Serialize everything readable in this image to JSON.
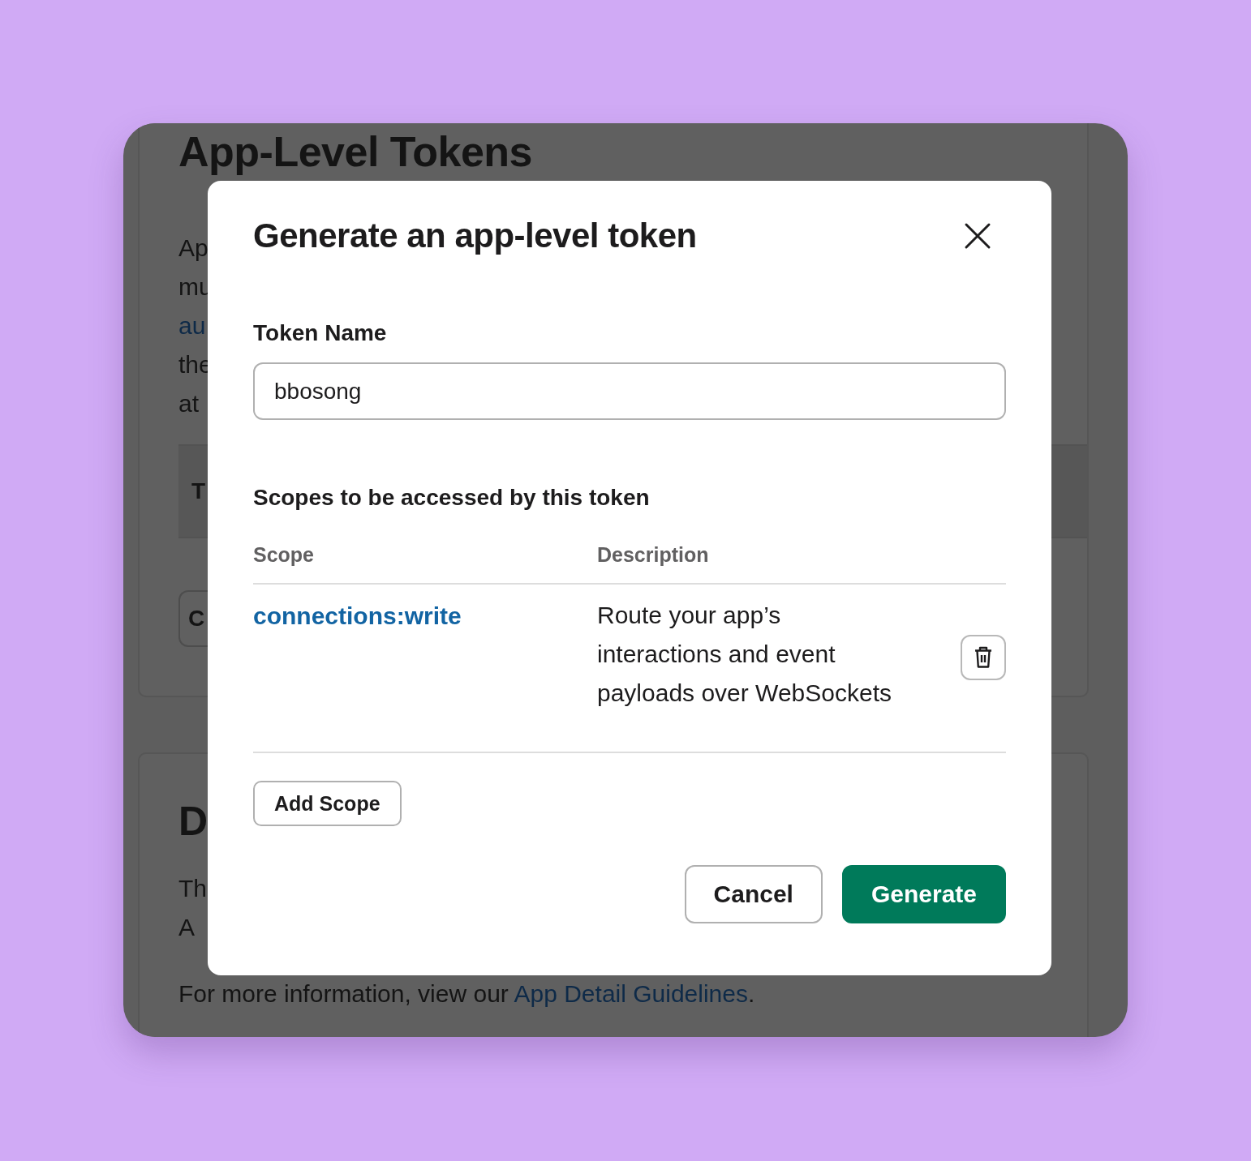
{
  "background_page": {
    "heading": "App-Level Tokens",
    "intro_lines": [
      {
        "text": "Ap",
        "kind": "text"
      },
      {
        "text": "mu",
        "kind": "text"
      },
      {
        "text": "au",
        "kind": "link"
      },
      {
        "text": "the",
        "kind": "text"
      },
      {
        "text": "at",
        "kind": "text"
      }
    ],
    "table_header": "T",
    "button": "C",
    "section_heading": "D",
    "section_lines": [
      "Th",
      "A"
    ],
    "info": {
      "text": "For more information, view our ",
      "link": "App Detail Guidelines",
      "end": "."
    }
  },
  "dialog": {
    "title": "Generate an app-level token",
    "token_name": {
      "label": "Token Name",
      "value": "bbosong"
    },
    "scopes_heading": "Scopes to be accessed by this token",
    "columns": [
      "Scope",
      "Description"
    ],
    "rows": [
      {
        "scope": "connections:write",
        "description": "Route your app’s interactions and event payloads over WebSockets"
      }
    ],
    "add_scope": "Add Scope",
    "buttons": [
      {
        "label": "Cancel",
        "kind": "secondary"
      },
      {
        "label": "Generate",
        "kind": "primary"
      }
    ]
  }
}
